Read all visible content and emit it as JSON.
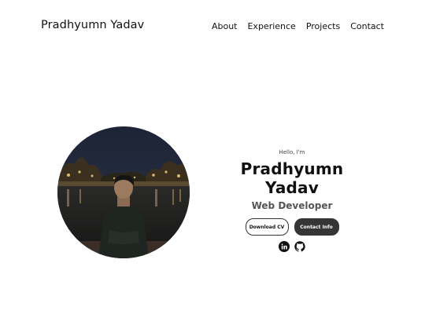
{
  "nav": {
    "logo": "Pradhyumn Yadav",
    "links": [
      "About",
      "Experience",
      "Projects",
      "Contact"
    ]
  },
  "hero": {
    "greeting": "Hello, I'm",
    "name": "Pradhyumn Yadav",
    "role": "Web Developer",
    "download_cv_label": "Download CV",
    "contact_info_label": "Contact Info",
    "social_icons": [
      "linkedin-icon",
      "github-icon"
    ]
  },
  "colors": {
    "text": "#111111",
    "subtitle": "#555555",
    "button_dark": "#353535"
  }
}
